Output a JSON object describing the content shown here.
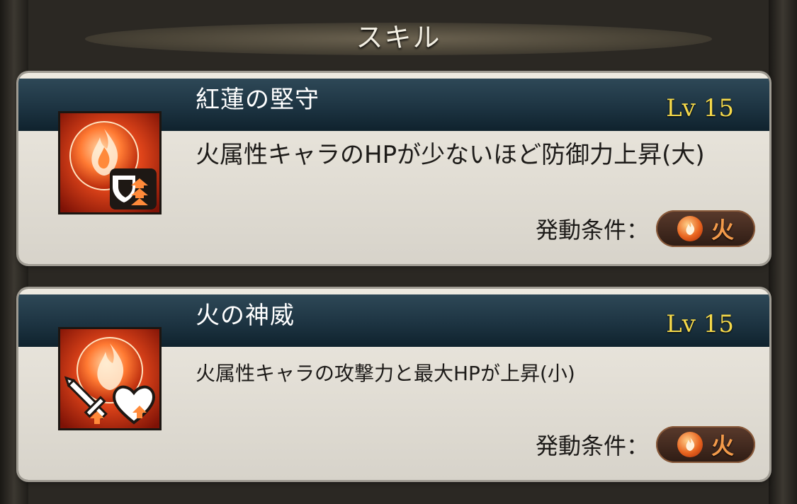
{
  "header": {
    "title": "スキル"
  },
  "skills": [
    {
      "name": "紅蓮の堅守",
      "level": "Lv 15",
      "description": "火属性キャラのHPが少ないほど防御力上昇(大)",
      "condition_label": "発動条件：",
      "condition_element": "火",
      "icon": "fire-orb-shield-up-icon"
    },
    {
      "name": "火の神威",
      "level": "Lv 15",
      "description": "火属性キャラの攻撃力と最大HPが上昇(小)",
      "condition_label": "発動条件：",
      "condition_element": "火",
      "icon": "fire-orb-sword-heart-up-icon"
    }
  ],
  "colors": {
    "level_text": "#f5d94a",
    "name_bar": "#1d3442",
    "fire_element": "#e8641f"
  }
}
